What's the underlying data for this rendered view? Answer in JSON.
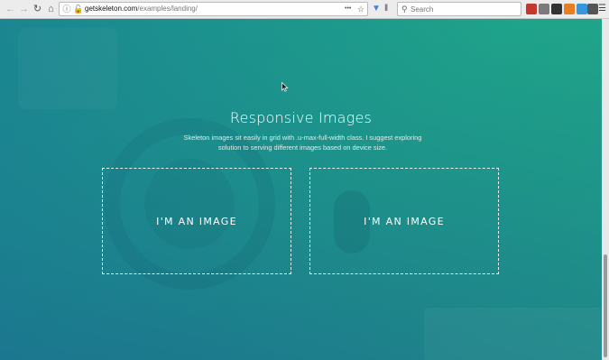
{
  "browser": {
    "url_host": "getskeleton.com",
    "url_path": "/examples/landing/",
    "more_label": "•••",
    "search_placeholder": "Search",
    "extensions": [
      {
        "name": "extension-red",
        "color": "#c0392b"
      },
      {
        "name": "extension-gray",
        "color": "#7a7a7a"
      },
      {
        "name": "extension-dark",
        "color": "#333333"
      },
      {
        "name": "extension-orange",
        "color": "#e67e22"
      },
      {
        "name": "extension-blue",
        "color": "#3498db"
      },
      {
        "name": "extension-gray2",
        "color": "#555555"
      }
    ]
  },
  "section": {
    "title": "Responsive Images",
    "description_line1": "Skeleton images sit easily in grid with .u-max-full-width class. I suggest exploring",
    "description_line2": "solution to serving different images based on device size.",
    "images": [
      {
        "label": "I'M AN IMAGE"
      },
      {
        "label": "I'M AN IMAGE"
      }
    ]
  },
  "colors": {
    "gradient_top": "#1fa48b",
    "gradient_bottom": "#1c738f",
    "text": "#ffffff"
  }
}
